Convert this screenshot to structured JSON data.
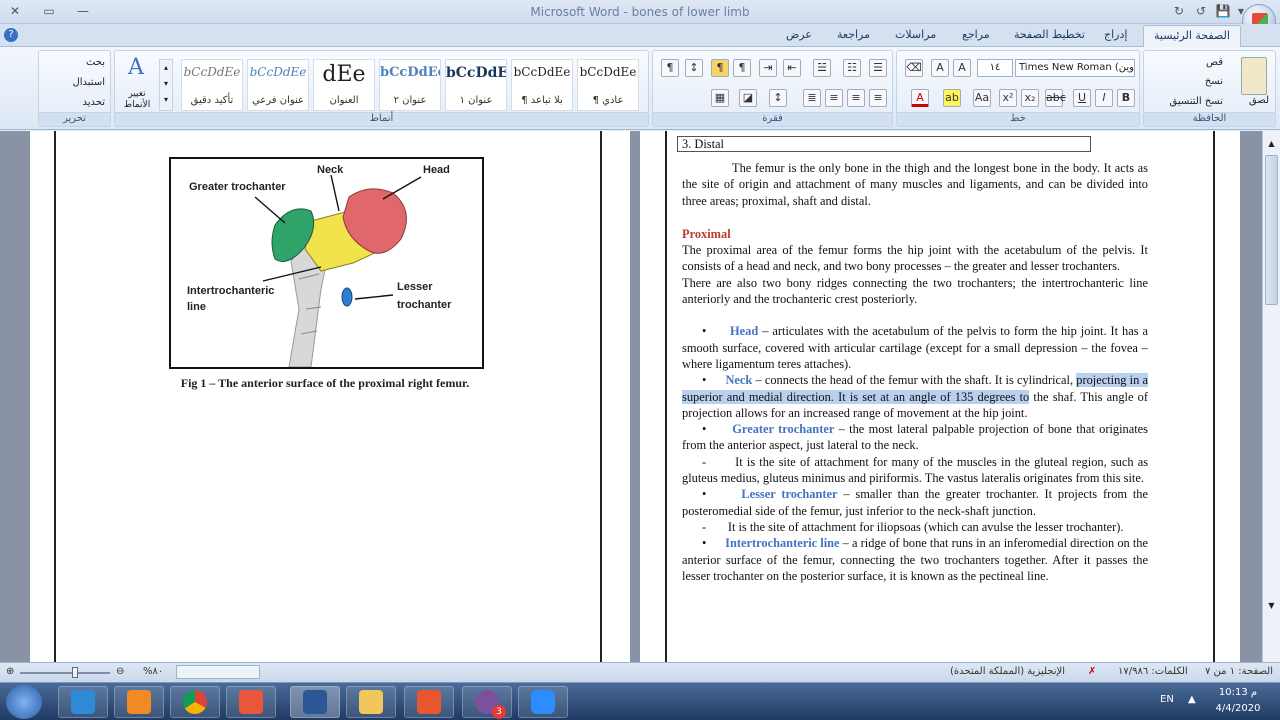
{
  "window": {
    "title": "Microsoft Word - bones of lower limb",
    "controls": [
      "✕",
      "▭",
      "—"
    ],
    "quick_access": [
      "💾",
      "↺",
      "↻",
      "▾"
    ]
  },
  "help_glyph": "?",
  "tabs": [
    {
      "label": "الصفحة الرئيسية",
      "active": true
    },
    {
      "label": "إدراج"
    },
    {
      "label": "تخطيط الصفحة"
    },
    {
      "label": "مراجع"
    },
    {
      "label": "مراسلات"
    },
    {
      "label": "مراجعة"
    },
    {
      "label": "عرض"
    }
  ],
  "ribbon": {
    "clipboard": {
      "label": "الحافظة",
      "paste": "لصق",
      "cut": "قص",
      "copy": "نسخ",
      "format_painter": "نسخ التنسيق"
    },
    "font": {
      "label": "خط",
      "name": "Times New Roman (ناوين",
      "size": "١٤"
    },
    "paragraph": {
      "label": "فقرة"
    },
    "styles": {
      "label": "أنماط",
      "items": [
        {
          "preview": "bCcDdEe",
          "name": "¶ عادي"
        },
        {
          "preview": "bCcDdEe",
          "name": "¶ بلا تباعد"
        },
        {
          "preview": "bCcDdEe",
          "name": "عنوان ١"
        },
        {
          "preview": "bCcDdEe",
          "name": "عنوان ٢"
        },
        {
          "preview": "dEe",
          "name": "العنوان"
        },
        {
          "preview": "bCcDdEe",
          "name": "عنوان فرعي"
        },
        {
          "preview": "bCcDdEe",
          "name": "تأكيد دقيق"
        }
      ],
      "change": "تغيير الأنماط"
    },
    "editing": {
      "label": "تحرير",
      "find": "بحث",
      "replace": "استبدال",
      "select": "تحديد"
    }
  },
  "left_page": {
    "figure": {
      "labels": {
        "greater": "Greater trochanter",
        "neck": "Neck",
        "head": "Head",
        "inter1": "Intertrochanteric",
        "inter2": "line",
        "lesser1": "Lesser",
        "lesser2": "trochanter"
      },
      "caption": "Fig 1 – The anterior surface of the proximal right femur."
    }
  },
  "right_page": {
    "distal_row": "3. Distal",
    "intro": "The femur is the only bone in the thigh and the longest bone in the body. It acts as the site of origin and attachment of many muscles and ligaments, and can be divided into three areas; proximal, shaft and distal.",
    "proximal_heading": "Proximal",
    "proximal_p1": "The proximal area of the femur forms the hip joint with the acetabulum of the pelvis. It consists of a head and neck, and two bony processes – the greater and lesser trochanters.",
    "proximal_p2": "There are also two bony ridges connecting the two trochanters; the intertrochanteric line anteriorly and the trochanteric crest posteriorly.",
    "bullets": [
      {
        "term": "Head",
        "text": " – articulates with the acetabulum of the pelvis to form the hip joint. It has a smooth surface, covered with articular cartilage (except for a small depression – the fovea – where ligamentum teres attaches)."
      },
      {
        "term": "Neck",
        "text_a": " – connects the head of the femur with the shaft. It is cylindrical, ",
        "text_hl": "projecting in a superior and medial direction. It is set at an angle of 135 degrees to",
        "text_b": " the shaf. This angle of projection allows for an increased range of movement at the hip joint."
      },
      {
        "term": "Greater trochanter",
        "text": " – the most lateral palpable projection of bone that originates from the anterior aspect, just lateral to the neck."
      },
      {
        "dash": "It is the site of attachment for many of the muscles in the gluteal region, such as gluteus medius, gluteus minimus and piriformis. The vastus lateralis originates from this site."
      },
      {
        "term": "Lesser trochanter",
        "text": " – smaller than the greater trochanter. It projects from the posteromedial side of the femur, just inferior to the neck-shaft junction."
      },
      {
        "dash": "It is the site of attachment for iliopsoas (which can avulse the lesser trochanter)."
      },
      {
        "term": "Intertrochanteric line",
        "text": " – a ridge of bone that runs in an inferomedial direction on the anterior surface of the femur, connecting the two trochanters together. After it passes the lesser trochanter on the posterior surface, it is known as the pectineal line."
      }
    ]
  },
  "statusbar": {
    "page": "الصفحة: ١ من ٧",
    "words": "الكلمات: ١٧/٩٨٦",
    "language": "الإنجليزية (المملكة المتحدة)",
    "zoom": "%٨٠"
  },
  "taskbar": {
    "lang": "EN",
    "time": "10:13 م",
    "date": "4/4/2020",
    "viber_badge": "3"
  },
  "colors": {
    "heading_red": "#c0392b",
    "term_blue": "#4472c4",
    "highlight": "#b9d1ee",
    "femur_head": "#e0676b",
    "femur_neck": "#f2e24b",
    "greater": "#2fa36a",
    "lesser": "#2e7fd1"
  }
}
